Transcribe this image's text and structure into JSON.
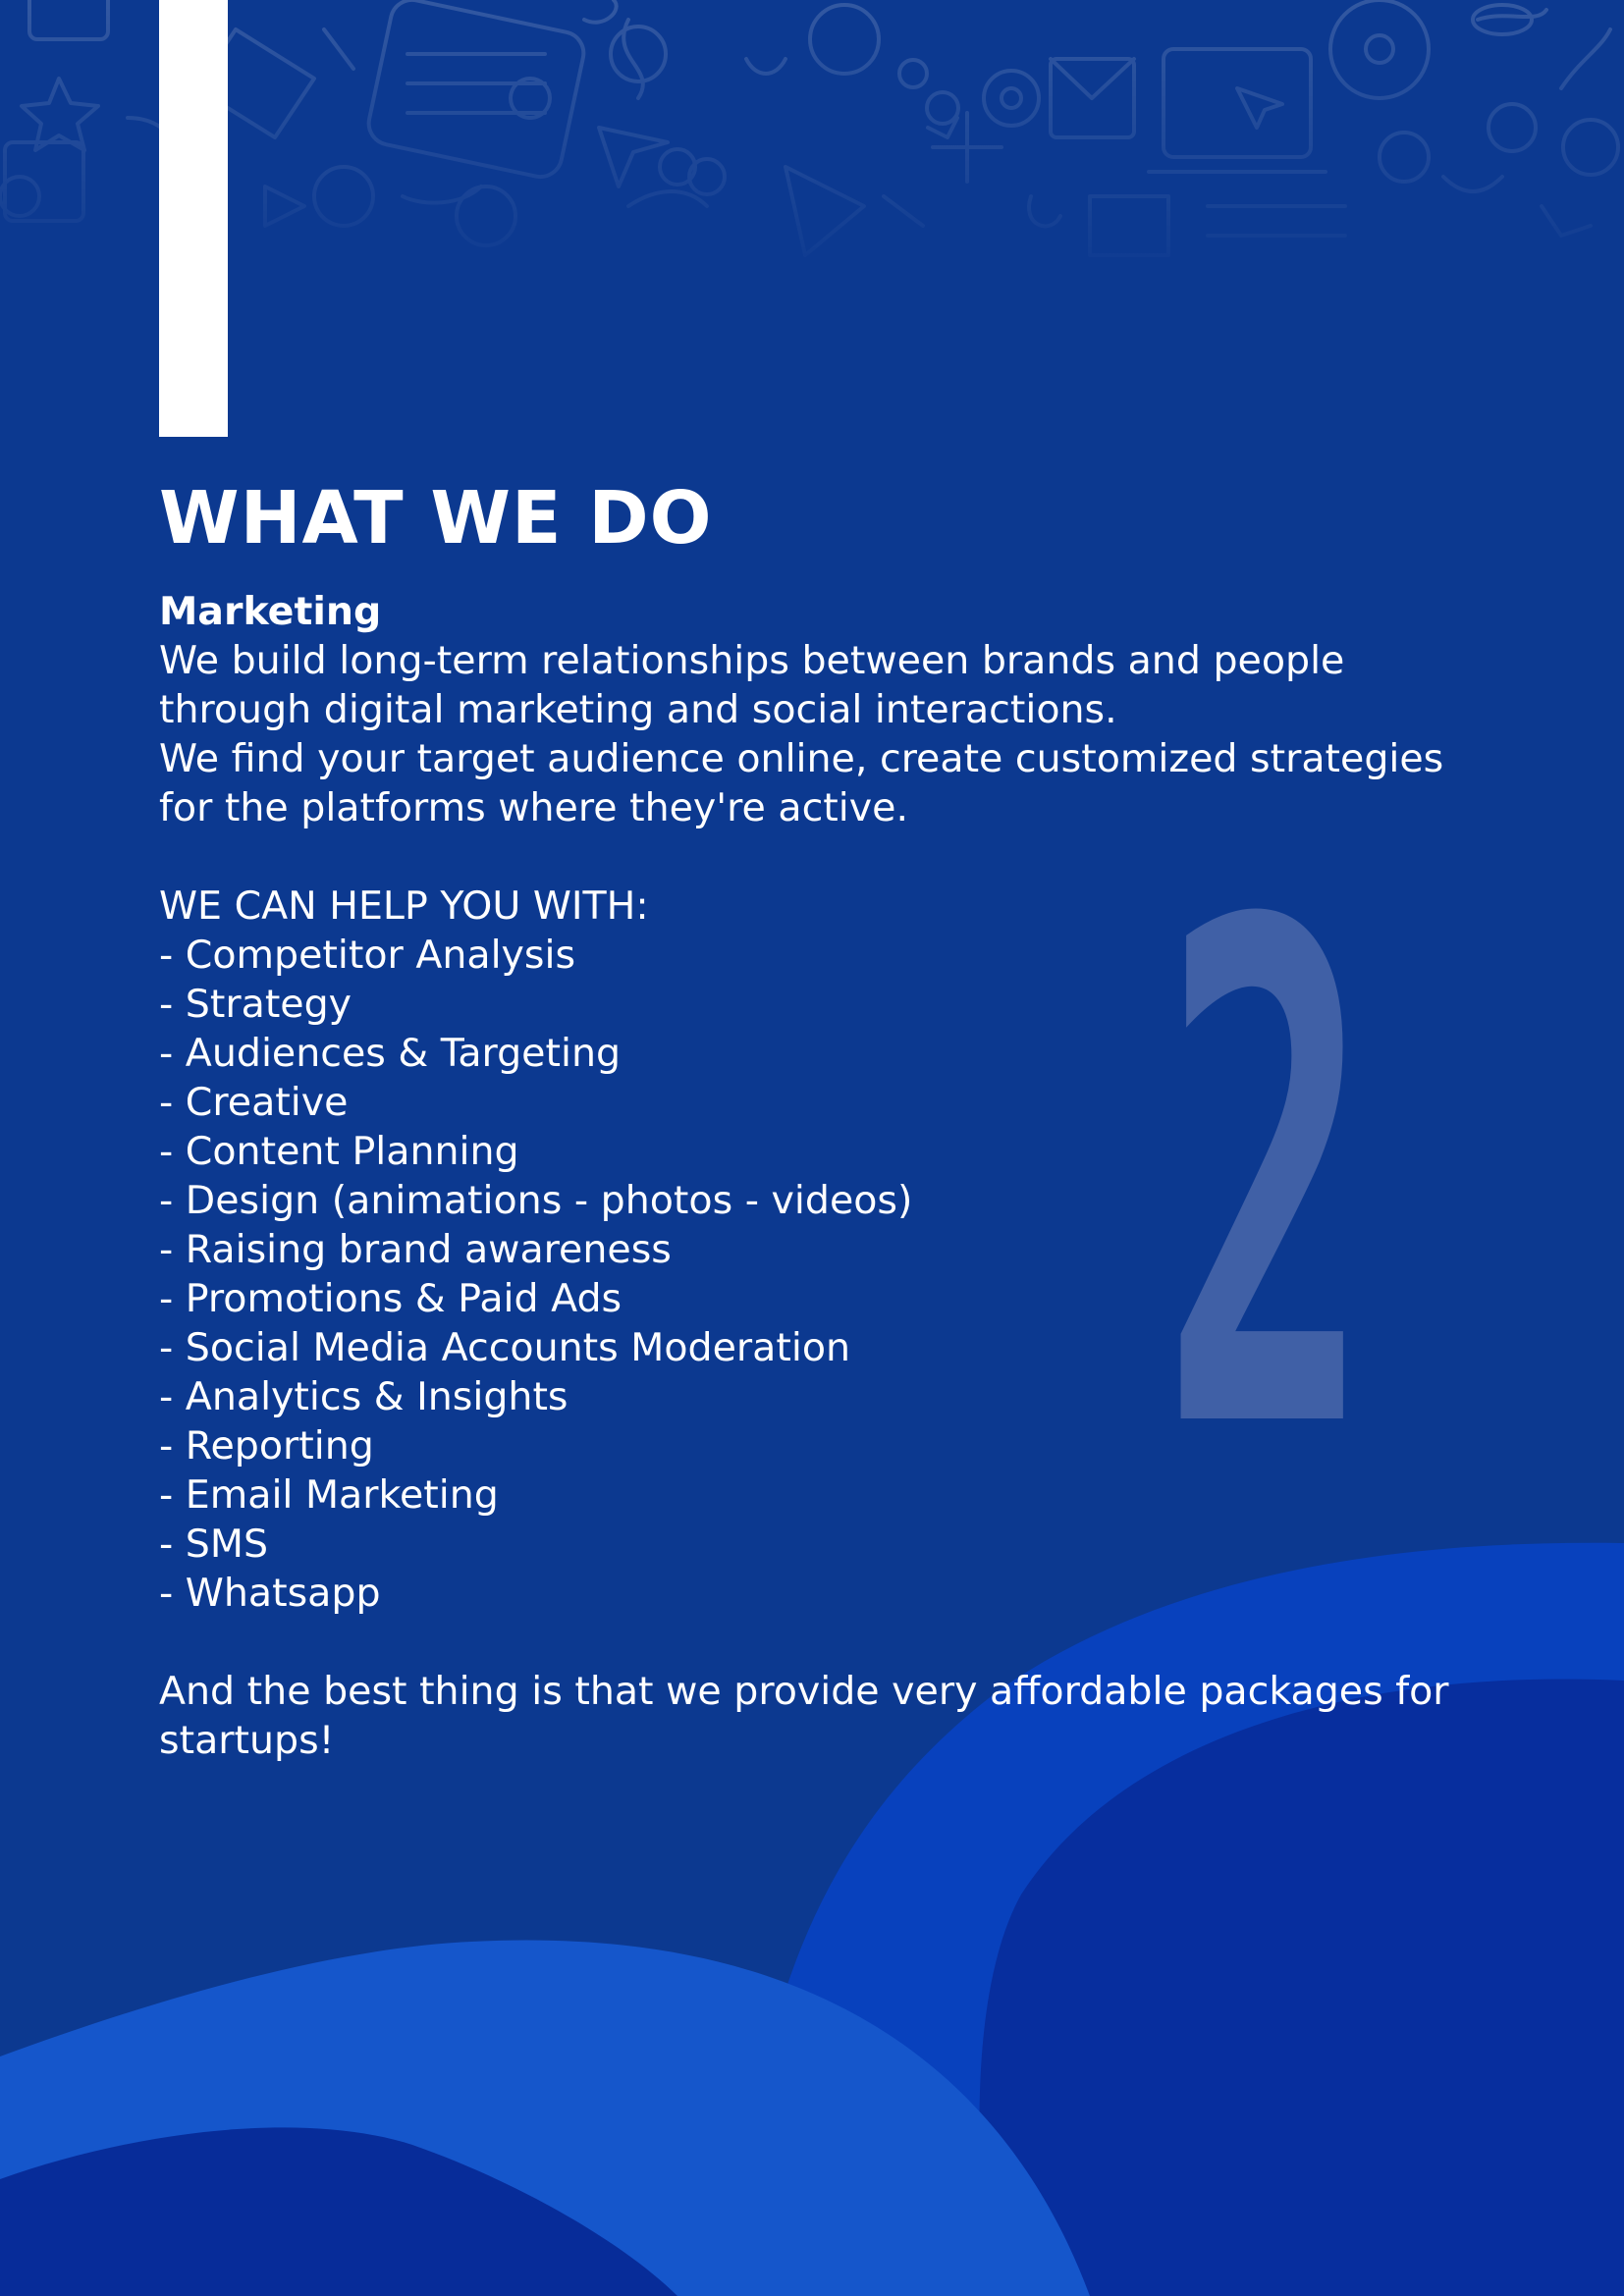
{
  "page": {
    "background": "#0c3990",
    "accent_light": "#1655cb",
    "accent_dark": "#072d9c",
    "decor_number": "2"
  },
  "title": "WHAT WE DO",
  "section": {
    "heading": "Marketing",
    "intro": [
      "We build long-term relationships between brands and people",
      "through digital marketing and social interactions.",
      "We find your target audience online, create customized strategies",
      "for the platforms where they're active."
    ],
    "help_heading": "WE CAN HELP YOU WITH:",
    "services": [
      "- Competitor Analysis",
      "- Strategy",
      "- Audiences & Targeting",
      "- Creative",
      "- Content Planning",
      "- Design (animations - photos - videos)",
      "- Raising brand awareness",
      "- Promotions & Paid Ads",
      "- Social Media Accounts Moderation",
      "- Analytics & Insights",
      "- Reporting",
      "- Email Marketing",
      "- SMS",
      "- Whatsapp"
    ],
    "closing": [
      "And the best thing is that we provide very affordable packages for",
      "startups!"
    ]
  }
}
